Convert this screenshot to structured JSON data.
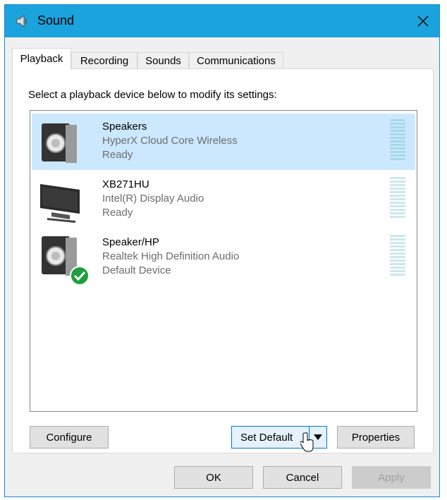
{
  "window": {
    "title": "Sound",
    "icon": "speaker-icon",
    "close_icon": "close-icon"
  },
  "tabs": [
    {
      "label": "Playback",
      "active": true
    },
    {
      "label": "Recording",
      "active": false
    },
    {
      "label": "Sounds",
      "active": false
    },
    {
      "label": "Communications",
      "active": false
    }
  ],
  "instruction": "Select a playback device below to modify its settings:",
  "devices": [
    {
      "name": "Speakers",
      "description": "HyperX Cloud Core Wireless",
      "status": "Ready",
      "icon": "speaker-icon",
      "selected": true,
      "default": false
    },
    {
      "name": "XB271HU",
      "description": "Intel(R) Display Audio",
      "status": "Ready",
      "icon": "monitor-icon",
      "selected": false,
      "default": false
    },
    {
      "name": "Speaker/HP",
      "description": "Realtek High Definition Audio",
      "status": "Default Device",
      "icon": "speaker-icon",
      "selected": false,
      "default": true
    }
  ],
  "panel_buttons": {
    "configure": "Configure",
    "set_default": "Set Default",
    "properties": "Properties"
  },
  "dialog_buttons": {
    "ok": "OK",
    "cancel": "Cancel",
    "apply": "Apply"
  },
  "colors": {
    "titlebar": "#1aa3dc",
    "selection": "#cce8ff",
    "meter": "#a8d8ea",
    "default_check": "#1e9e3e",
    "focus_border": "#0078d7"
  }
}
